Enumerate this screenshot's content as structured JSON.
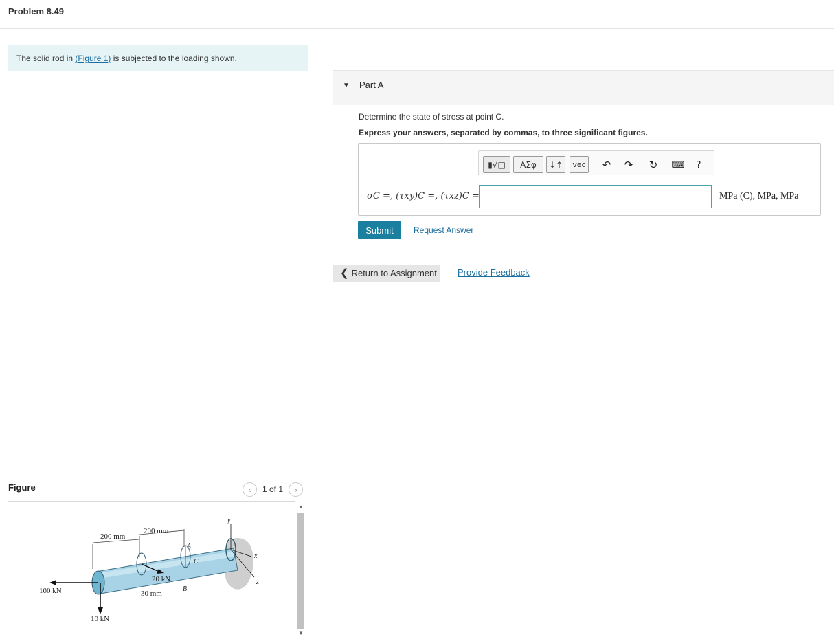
{
  "header": {
    "title": "Problem 8.49"
  },
  "intro": {
    "prefix": "The solid rod in ",
    "link_open": "(",
    "link": "Figure 1",
    "link_close": ")",
    "suffix": " is subjected to the loading shown."
  },
  "figure": {
    "label": "Figure",
    "page": "1 of 1",
    "labels": {
      "dim_left": "200 mm",
      "dim_right": "200 mm",
      "force_100": "100 kN",
      "force_10": "10 kN",
      "force_20": "20 kN",
      "radius": "30 mm",
      "point_a": "A",
      "point_b": "B",
      "point_c": "C",
      "axis_x": "x",
      "axis_y": "y",
      "axis_z": "z"
    }
  },
  "part": {
    "title": "Part A"
  },
  "question": {
    "prompt": "Determine the state of stress at point C.",
    "instruction": "Express your answers, separated by commas, to three significant figures."
  },
  "answer": {
    "label": "σC =, (τxy)C =, (τxz)C =",
    "value": "",
    "units": "MPa (C), MPa, MPa"
  },
  "toolbar": {
    "greek": "ΑΣφ",
    "sort": "↓↑",
    "vec": "vec",
    "help": "?"
  },
  "actions": {
    "submit": "Submit",
    "request": "Request Answer",
    "return": "Return to Assignment",
    "feedback": "Provide Feedback"
  },
  "colors": {
    "accent": "#1b7fa0",
    "link": "#1a6fa0",
    "intro_bg": "#e6f4f5",
    "rod": "#a8d3e6"
  }
}
